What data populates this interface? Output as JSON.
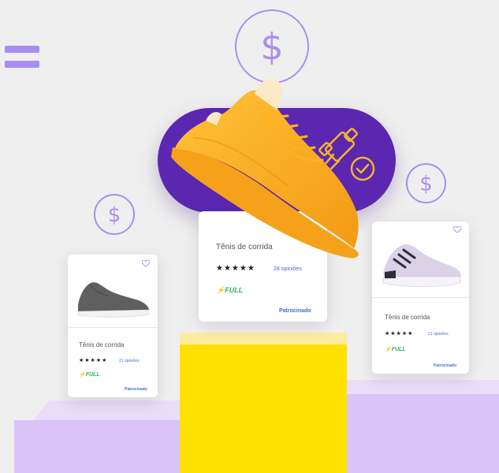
{
  "icons": {
    "menu": "hamburger-menu-icon",
    "coin": "dollar-coin-icon",
    "auction": "gavel-check-icon",
    "favorite": "heart-outline-icon",
    "lightning": "lightning-icon"
  },
  "colors": {
    "accent_purple": "#5b27b0",
    "light_purple": "#a98ef2",
    "podium_yellow": "#ffe100",
    "floor_lavender": "#d9c3f7",
    "shoe_orange": "#f7a81b",
    "full_green": "#2cb35b",
    "link_blue": "#3f6fdc"
  },
  "cards": {
    "center": {
      "title": "Tênis de corrida",
      "stars": "★★★★★",
      "reviews": "28 opiniões",
      "badge": "FULL",
      "sponsored": "Patrocinado"
    },
    "left": {
      "title": "Tênis de corrida",
      "stars": "★★★★★",
      "reviews": "21 opiniões",
      "badge": "FULL",
      "sponsored": "Patrocinado"
    },
    "right": {
      "title": "Tênis de corrida",
      "stars": "★★★★★",
      "reviews": "21 opiniões",
      "badge": "FULL",
      "sponsored": "Patrocinado"
    }
  }
}
